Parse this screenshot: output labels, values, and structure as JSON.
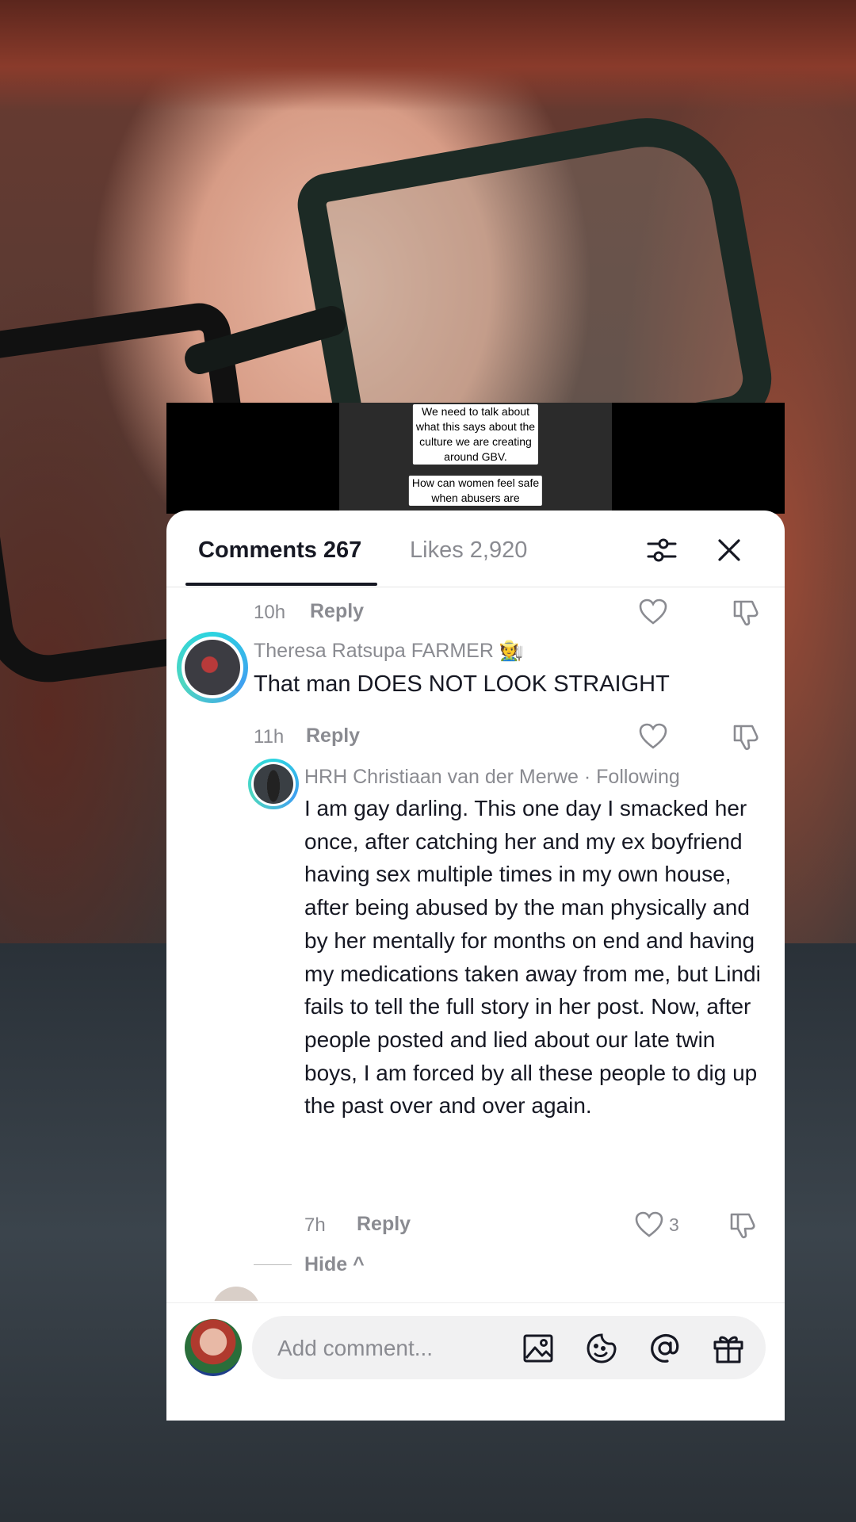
{
  "video_caption": {
    "lines1": "We need to talk about\nwhat this says about the\nculture we are creating\naround GBV.",
    "lines2": "How can women feel safe\nwhen abusers are"
  },
  "tabs": {
    "comments_label": "Comments 267",
    "likes_label": "Likes 2,920"
  },
  "comments": [
    {
      "time": "10h",
      "reply_label": "Reply"
    },
    {
      "username": "Theresa Ratsupa FARMER 🧑‍🌾",
      "text": "That man DOES NOT LOOK STRAIGHT",
      "time": "11h",
      "reply_label": "Reply"
    }
  ],
  "reply": {
    "username": "HRH Christiaan van der Merwe · Following",
    "text": "I am gay darling. This one day I smacked her once, after catching her and my ex boyfriend having sex multiple times in my own house, after being abused by the man physically and by her mentally for months on end and having my medications taken away from me, but Lindi fails to tell the full story in her post. Now, after people posted and lied about our late twin boys, I am forced by all these people to dig up the past over and over again.",
    "time": "7h",
    "reply_label": "Reply",
    "like_count": "3",
    "hide_label": "Hide ^"
  },
  "input": {
    "placeholder": "Add comment..."
  },
  "icons": [
    "filter-icon",
    "close-icon",
    "heart-icon",
    "dislike-icon",
    "image-icon",
    "emoji-icon",
    "mention-icon",
    "gift-icon"
  ]
}
